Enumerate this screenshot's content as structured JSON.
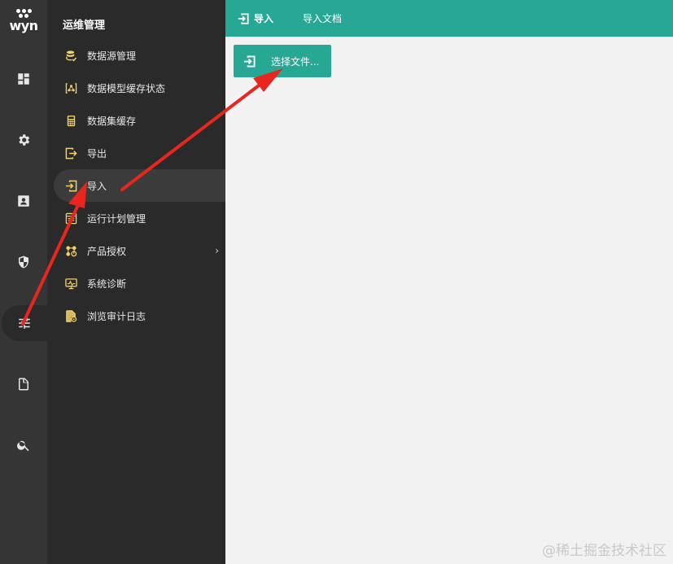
{
  "logo": {
    "text": "wyn"
  },
  "rail": {
    "items": [
      {
        "icon": "dashboard-icon"
      },
      {
        "icon": "gear-icon"
      },
      {
        "icon": "contact-card-icon"
      },
      {
        "icon": "shield-icon"
      },
      {
        "icon": "sliders-icon",
        "active": true
      },
      {
        "icon": "document-icon"
      },
      {
        "icon": "search-icon"
      }
    ]
  },
  "submenu": {
    "title": "运维管理",
    "items": [
      {
        "label": "数据源管理",
        "icon": "database-icon"
      },
      {
        "label": "数据模型缓存状态",
        "icon": "model-cache-icon"
      },
      {
        "label": "数据集缓存",
        "icon": "calculator-icon"
      },
      {
        "label": "导出",
        "icon": "export-icon"
      },
      {
        "label": "导入",
        "icon": "import-icon",
        "active": true
      },
      {
        "label": "运行计划管理",
        "icon": "schedule-icon"
      },
      {
        "label": "产品授权",
        "icon": "license-icon",
        "has_submenu": true
      },
      {
        "label": "系统诊断",
        "icon": "monitor-icon"
      },
      {
        "label": "浏览审计日志",
        "icon": "audit-log-icon"
      }
    ]
  },
  "topbar": {
    "tabs": [
      {
        "label": "导入",
        "active": true
      },
      {
        "label": "导入文档"
      }
    ]
  },
  "main": {
    "select_file_button": "选择文件..."
  },
  "watermark": "@稀土掘金技术社区",
  "colors": {
    "accent": "#27a895",
    "rail_bg": "#353535",
    "submenu_bg": "#2a2a2a",
    "menu_icon": "#f2d16b",
    "annotation_arrow": "#e8261f"
  }
}
